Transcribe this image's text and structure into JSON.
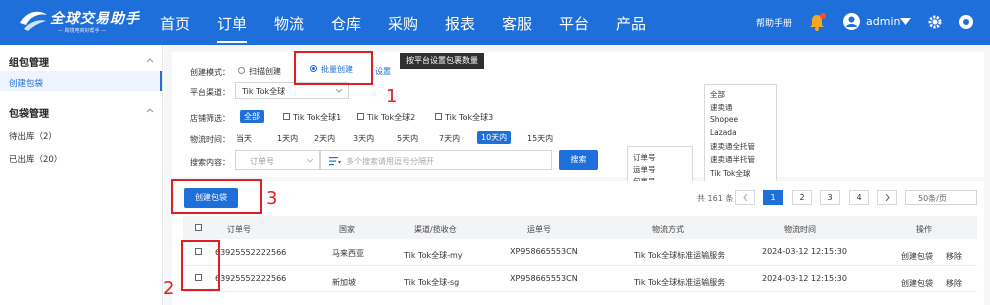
{
  "brand": {
    "name": "全球交易助手",
    "slogan": "— 跨境电商好帮手 —"
  },
  "nav": {
    "items": [
      "首页",
      "订单",
      "物流",
      "仓库",
      "采购",
      "报表",
      "客服",
      "平台",
      "产品"
    ],
    "active": "订单",
    "help": "帮助手册",
    "user": "admin"
  },
  "sidebar": {
    "group1": "组包管理",
    "group1_items": [
      "创建包袋"
    ],
    "group2": "包袋管理",
    "group2_items": [
      "待出库（2）",
      "已出库（20）"
    ]
  },
  "form": {
    "create_mode_label": "创建模式：",
    "mode_scan": "扫描创建",
    "mode_batch": "批量创建",
    "settings_link": "设置",
    "tooltip": "按平台设置包裹数量",
    "channel_label": "平台渠道：",
    "channel_value": "Tik Tok全球",
    "store_label": "店铺筛选：",
    "store_all": "全部",
    "stores": [
      "Tik Tok全球1",
      "Tik Tok全球2",
      "Tik Tok全球3"
    ],
    "time_label": "物流时间：",
    "time_options": [
      "当天",
      "1天内",
      "2天内",
      "3天内",
      "5天内",
      "7天内",
      "10天内",
      "15天内"
    ],
    "time_active": "10天内",
    "search_label": "搜索内容：",
    "search_type": "订单号",
    "search_placeholder": "多个搜索请用逗号分隔开",
    "search_button": "搜索",
    "search_type_options": [
      "订单号",
      "运单号",
      "包裹号"
    ],
    "channel_options": [
      "全部",
      "速卖通",
      "Shopee",
      "Lazada",
      "速卖通全托管",
      "速卖通半托管",
      "Tik Tok全球"
    ]
  },
  "toolbar": {
    "create_button": "创建包袋"
  },
  "pagination": {
    "total": "共 161 条",
    "pages": [
      "1",
      "2",
      "3",
      "4"
    ],
    "current": "1",
    "page_size": "50条/页"
  },
  "table": {
    "headers": [
      "订单号",
      "国家",
      "渠道/揽收仓",
      "运单号",
      "物流方式",
      "物流时间",
      "操作"
    ],
    "rows": [
      {
        "order": "63925552222566",
        "country": "马来西亚",
        "channel": "Tik Tok全球-my",
        "tracking": "XP958665553CN",
        "method": "Tik Tok全球标准运输服务",
        "time": "2024-03-12 12:15:30",
        "action1": "创建包袋",
        "action2": "移除"
      },
      {
        "order": "63925552222566",
        "country": "新加坡",
        "channel": "Tik Tok全球-sg",
        "tracking": "XP958665553CN",
        "method": "Tik Tok全球标准运输服务",
        "time": "2024-03-12 12:15:30",
        "action1": "创建包袋",
        "action2": "移除"
      }
    ]
  },
  "annotations": [
    "1",
    "2",
    "3"
  ],
  "colors": {
    "primary": "#1e6fd9",
    "annotation": "#e02020"
  }
}
